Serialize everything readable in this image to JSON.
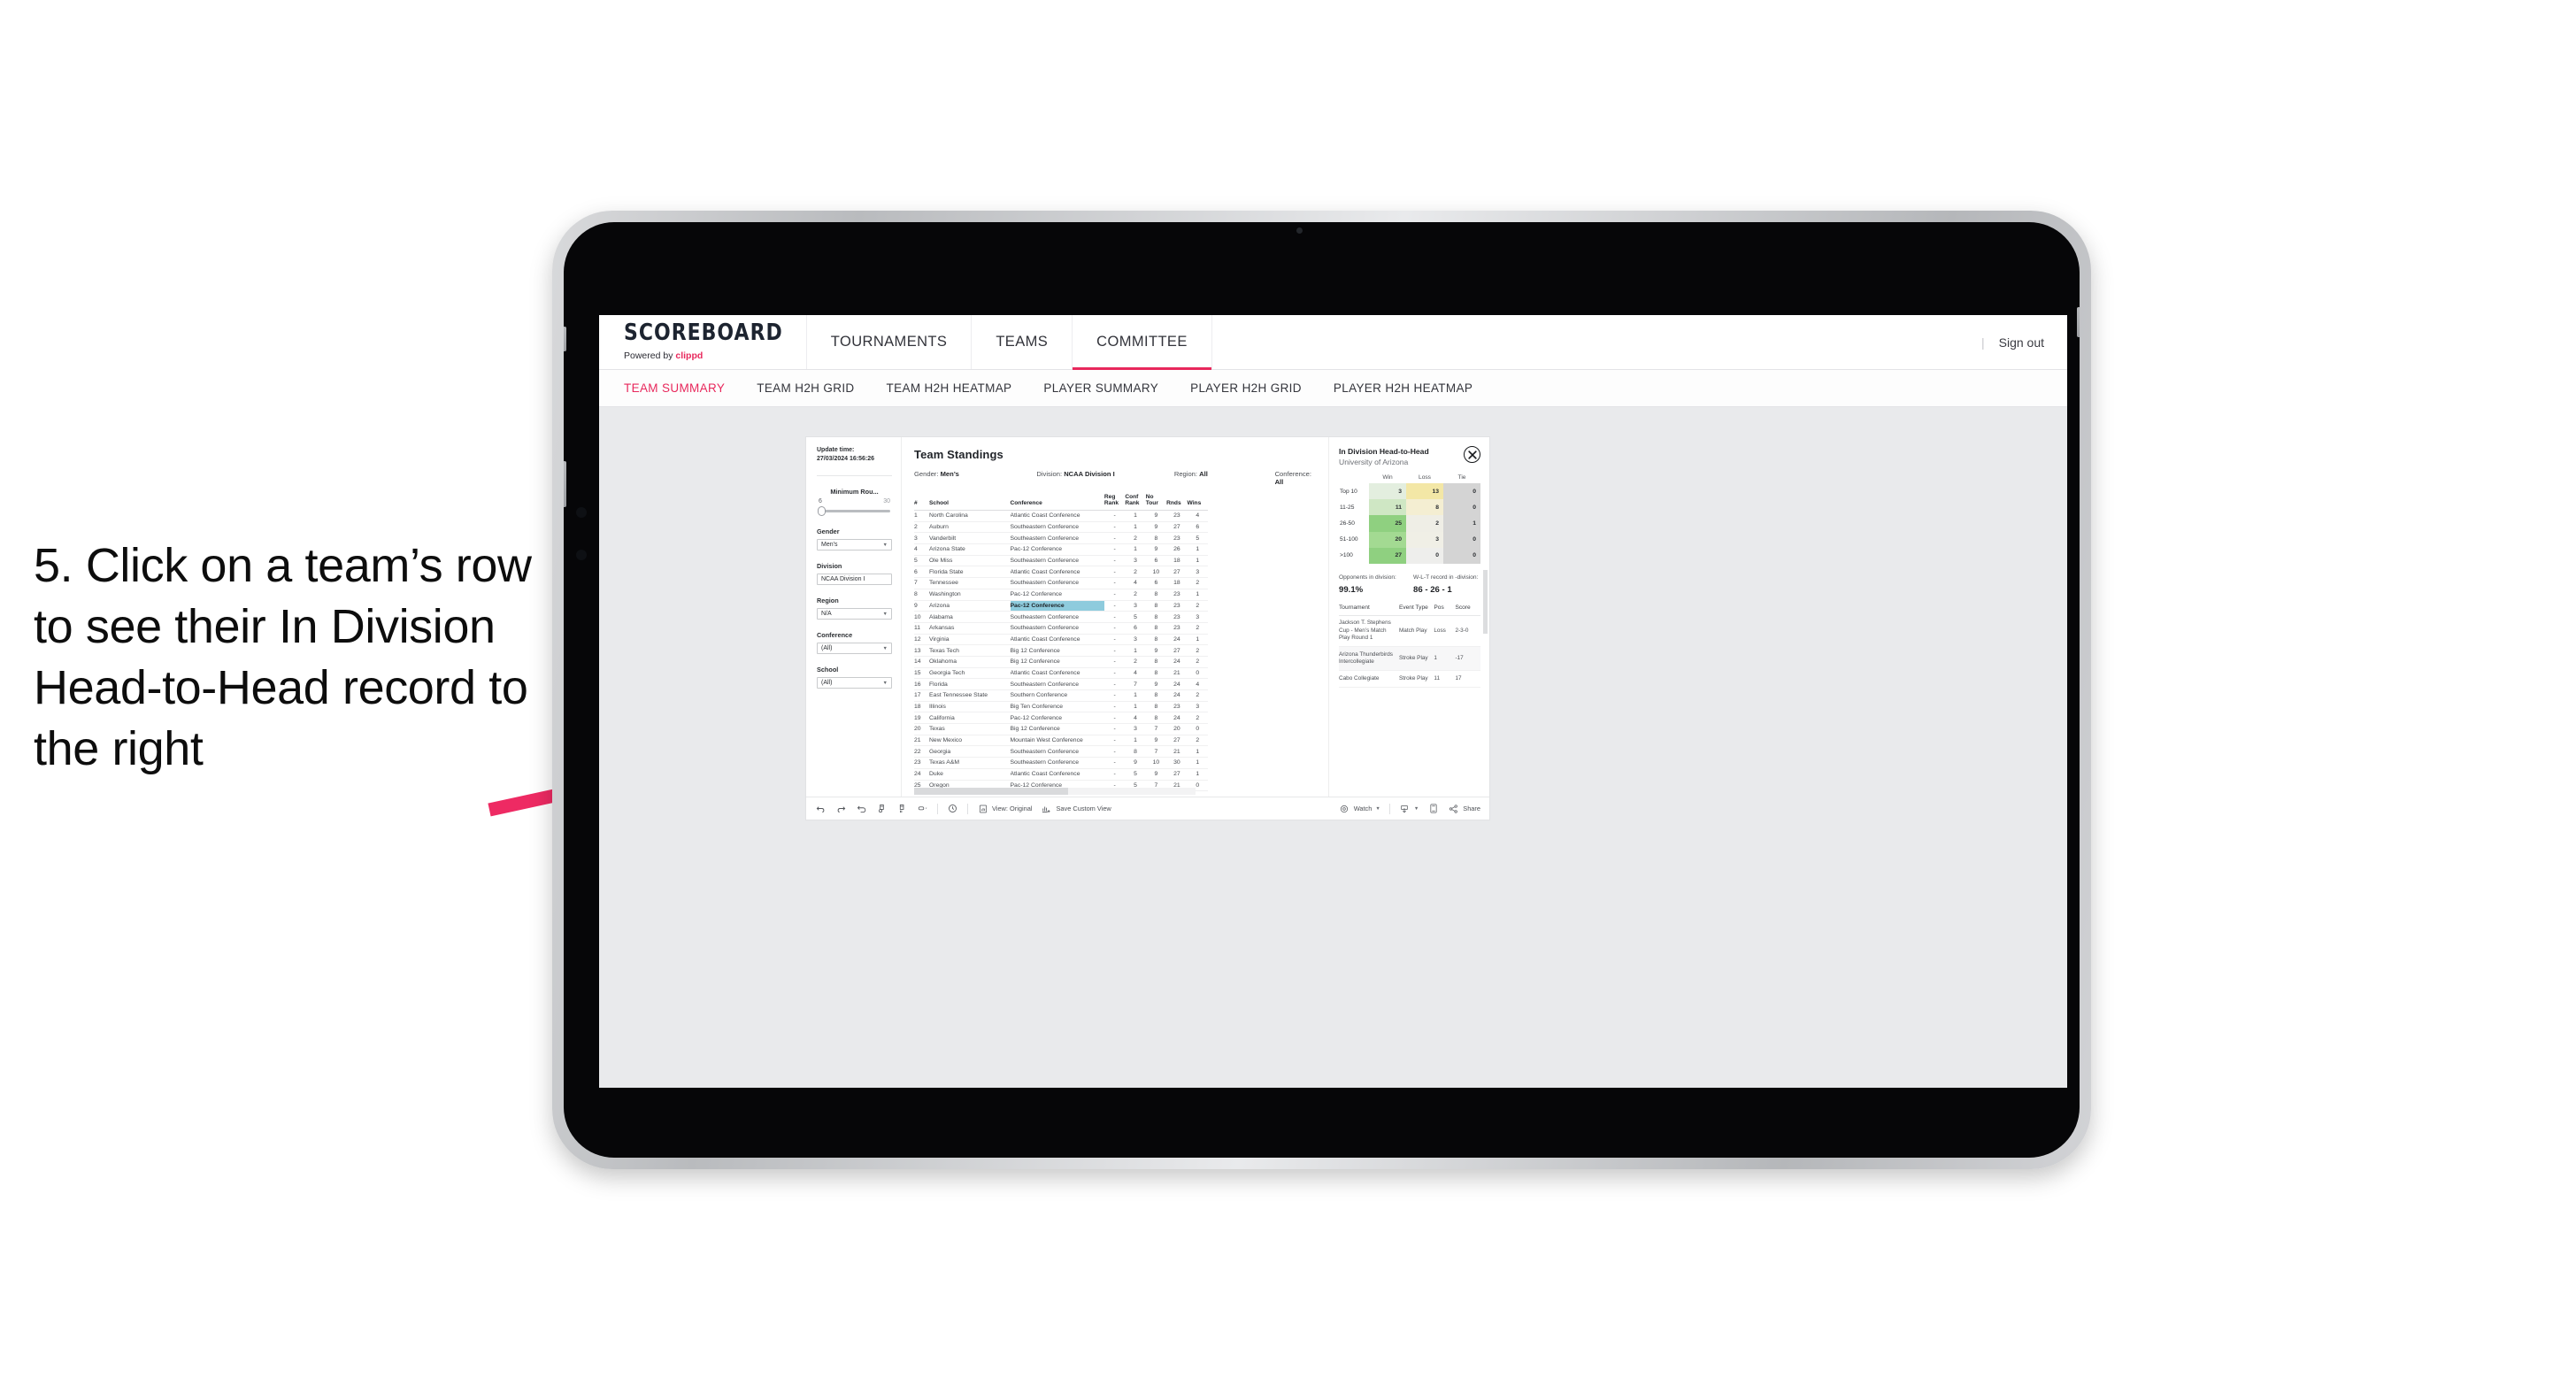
{
  "annotation": {
    "text": "5. Click on a team’s row to see their In Division Head-to-Head record to the right",
    "arrow_color": "#ee2a63"
  },
  "app": {
    "logo": {
      "word": "SCOREBOARD",
      "powered_prefix": "Powered by ",
      "powered_brand": "clippd"
    },
    "top_nav": [
      {
        "label": "TOURNAMENTS",
        "active": false
      },
      {
        "label": "TEAMS",
        "active": false
      },
      {
        "label": "COMMITTEE",
        "active": true
      }
    ],
    "top_right": {
      "divider": "|",
      "sign_out": "Sign out"
    },
    "sub_nav": [
      {
        "label": "TEAM SUMMARY",
        "active": true
      },
      {
        "label": "TEAM H2H GRID",
        "active": false
      },
      {
        "label": "TEAM H2H HEATMAP",
        "active": false
      },
      {
        "label": "PLAYER SUMMARY",
        "active": false
      },
      {
        "label": "PLAYER H2H GRID",
        "active": false
      },
      {
        "label": "PLAYER H2H HEATMAP",
        "active": false
      }
    ]
  },
  "filters": {
    "update_time_label": "Update time:",
    "update_time_value": "27/03/2024 16:56:26",
    "slider": {
      "label": "Minimum Rou...",
      "min": "6",
      "max": "30"
    },
    "selects": [
      {
        "label": "Gender",
        "value": "Men’s",
        "has_caret": true
      },
      {
        "label": "Division",
        "value": "NCAA Division I",
        "has_caret": false
      },
      {
        "label": "Region",
        "value": "N/A",
        "has_caret": true
      },
      {
        "label": "Conference",
        "value": "(All)",
        "has_caret": true
      },
      {
        "label": "School",
        "value": "(All)",
        "has_caret": true
      }
    ]
  },
  "standings": {
    "title": "Team Standings",
    "meta": [
      {
        "label": "Gender: ",
        "value": "Men’s"
      },
      {
        "label": "Division: ",
        "value": "NCAA Division I"
      },
      {
        "label": "Region: ",
        "value": "All"
      },
      {
        "label": "Conference: ",
        "value": "All"
      }
    ],
    "columns": [
      "#",
      "School",
      "Conference",
      "Reg Rank",
      "Conf Rank",
      "No Tour",
      "Rnds",
      "Wins"
    ],
    "selected_row_index": 8,
    "rows": [
      [
        "1",
        "North Carolina",
        "Atlantic Coast Conference",
        "-",
        "1",
        "9",
        "23",
        "4"
      ],
      [
        "2",
        "Auburn",
        "Southeastern Conference",
        "-",
        "1",
        "9",
        "27",
        "6"
      ],
      [
        "3",
        "Vanderbilt",
        "Southeastern Conference",
        "-",
        "2",
        "8",
        "23",
        "5"
      ],
      [
        "4",
        "Arizona State",
        "Pac-12 Conference",
        "-",
        "1",
        "9",
        "26",
        "1"
      ],
      [
        "5",
        "Ole Miss",
        "Southeastern Conference",
        "-",
        "3",
        "6",
        "18",
        "1"
      ],
      [
        "6",
        "Florida State",
        "Atlantic Coast Conference",
        "-",
        "2",
        "10",
        "27",
        "3"
      ],
      [
        "7",
        "Tennessee",
        "Southeastern Conference",
        "-",
        "4",
        "6",
        "18",
        "2"
      ],
      [
        "8",
        "Washington",
        "Pac-12 Conference",
        "-",
        "2",
        "8",
        "23",
        "1"
      ],
      [
        "9",
        "Arizona",
        "Pac-12 Conference",
        "-",
        "3",
        "8",
        "23",
        "2"
      ],
      [
        "10",
        "Alabama",
        "Southeastern Conference",
        "-",
        "5",
        "8",
        "23",
        "3"
      ],
      [
        "11",
        "Arkansas",
        "Southeastern Conference",
        "-",
        "6",
        "8",
        "23",
        "2"
      ],
      [
        "12",
        "Virginia",
        "Atlantic Coast Conference",
        "-",
        "3",
        "8",
        "24",
        "1"
      ],
      [
        "13",
        "Texas Tech",
        "Big 12 Conference",
        "-",
        "1",
        "9",
        "27",
        "2"
      ],
      [
        "14",
        "Oklahoma",
        "Big 12 Conference",
        "-",
        "2",
        "8",
        "24",
        "2"
      ],
      [
        "15",
        "Georgia Tech",
        "Atlantic Coast Conference",
        "-",
        "4",
        "8",
        "21",
        "0"
      ],
      [
        "16",
        "Florida",
        "Southeastern Conference",
        "-",
        "7",
        "9",
        "24",
        "4"
      ],
      [
        "17",
        "East Tennessee State",
        "Southern Conference",
        "-",
        "1",
        "8",
        "24",
        "2"
      ],
      [
        "18",
        "Illinois",
        "Big Ten Conference",
        "-",
        "1",
        "8",
        "23",
        "3"
      ],
      [
        "19",
        "California",
        "Pac-12 Conference",
        "-",
        "4",
        "8",
        "24",
        "2"
      ],
      [
        "20",
        "Texas",
        "Big 12 Conference",
        "-",
        "3",
        "7",
        "20",
        "0"
      ],
      [
        "21",
        "New Mexico",
        "Mountain West Conference",
        "-",
        "1",
        "9",
        "27",
        "2"
      ],
      [
        "22",
        "Georgia",
        "Southeastern Conference",
        "-",
        "8",
        "7",
        "21",
        "1"
      ],
      [
        "23",
        "Texas A&M",
        "Southeastern Conference",
        "-",
        "9",
        "10",
        "30",
        "1"
      ],
      [
        "24",
        "Duke",
        "Atlantic Coast Conference",
        "-",
        "5",
        "9",
        "27",
        "1"
      ],
      [
        "25",
        "Oregon",
        "Pac-12 Conference",
        "-",
        "5",
        "7",
        "21",
        "0"
      ]
    ]
  },
  "h2h": {
    "title": "In Division Head-to-Head",
    "subtitle": "University of Arizona",
    "close_icon": "close-icon",
    "columns": [
      "",
      "Win",
      "Loss",
      "Tie"
    ],
    "rows": [
      {
        "label": "Top 10",
        "win": "3",
        "loss": "13",
        "tie": "0",
        "win_color": "#e3eedf",
        "loss_color": "#f3e7a6",
        "tie_color": "#d4d4d4"
      },
      {
        "label": "11-25",
        "win": "11",
        "loss": "8",
        "tie": "0",
        "win_color": "#cfe7c4",
        "loss_color": "#f4eed2",
        "tie_color": "#d4d4d4"
      },
      {
        "label": "26-50",
        "win": "25",
        "loss": "2",
        "tie": "1",
        "win_color": "#8fd080",
        "loss_color": "#efeee6",
        "tie_color": "#d4d4d4"
      },
      {
        "label": "51-100",
        "win": "20",
        "loss": "3",
        "tie": "0",
        "win_color": "#a3da92",
        "loss_color": "#f0efe6",
        "tie_color": "#d4d4d4"
      },
      {
        "label": ">100",
        "win": "27",
        "loss": "0",
        "tie": "0",
        "win_color": "#8fd080",
        "loss_color": "#eeeeec",
        "tie_color": "#d4d4d4"
      }
    ],
    "stats": [
      {
        "label": "Opponents in division:",
        "value": "99.1%"
      },
      {
        "label": "W-L-T record in -division:",
        "value": "86 - 26 - 1"
      }
    ],
    "tournament_columns": [
      "Tournament",
      "Event Type",
      "Pos",
      "Score"
    ],
    "tournaments": [
      {
        "name": "Jackson T. Stephens Cup - Men’s Match Play Round 1",
        "type": "Match Play",
        "pos": "Loss",
        "score": "2-3-0"
      },
      {
        "name": "Arizona Thunderbirds Intercollegiate",
        "type": "Stroke Play",
        "pos": "1",
        "score": "-17"
      },
      {
        "name": "Cabo Collegiate",
        "type": "Stroke Play",
        "pos": "11",
        "score": "17"
      }
    ]
  },
  "toolbar": {
    "icons": [
      "undo-icon",
      "redo-icon",
      "revert-icon",
      "refresh-data-icon",
      "pause-updates-icon",
      "highlight-icon"
    ],
    "alerts_icon": "alerts-icon",
    "view_label": "View: Original",
    "view_icon": "view-original-icon",
    "save_label": "Save Custom View",
    "save_icon": "save-custom-view-icon",
    "watch_label": "Watch",
    "watch_icon": "watch-icon",
    "download_icon": "download-icon",
    "device_icon": "device-layout-icon",
    "share_label": "Share",
    "share_icon": "share-icon"
  }
}
